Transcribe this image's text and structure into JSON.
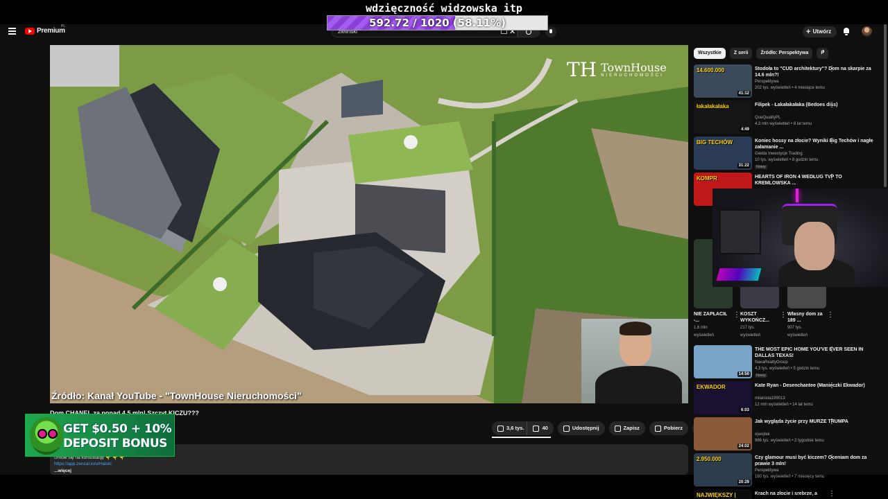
{
  "overlay": {
    "title": "wdzięczność widzowska itp",
    "goal_text": "592.72 / 1020 (58.11%)",
    "goal_fraction": 0.5811
  },
  "masthead": {
    "logo_text": "Premium",
    "logo_country": "PL",
    "search_value": "zieliński",
    "create_label": "Utwórz"
  },
  "video": {
    "watermark_mark": "TH",
    "watermark_brand": "TownHouse",
    "watermark_sub": "NIERUCHOMOŚCI",
    "source_caption": "Źródło: Kanał YouTube - \"TownHouse Nieruchomości\"",
    "title": "Dom CHANEL za ponad 4,5 mln! Szczyt KICZU???"
  },
  "actions": {
    "likes": "3,6 tys.",
    "dislikes": "40",
    "share": "Udostępnij",
    "save": "Zapisz",
    "download": "Pobierz"
  },
  "description": {
    "line1": "Umów się na konsultację 👇 👇 👇",
    "link": "https://app.zencal.io/u/Halski",
    "more": "...więcej"
  },
  "ad": {
    "line1": "GET $0.50 + 10%",
    "line2": "DEPOSIT BONUS"
  },
  "chips": [
    "Wszystkie",
    "Z serii",
    "Źródło: Perspektywa",
    "P"
  ],
  "recommendations": [
    {
      "title": "Stodoła to \"CUD architektury\"? Dom na skarpie za 14.6 mln?!",
      "channel": "Perspektywa",
      "meta": "202 tys. wyświetleń • 4 miesiące temu",
      "duration": "41:12",
      "thumb_text": "14.600.000",
      "thumb_color": "#3a4a5a"
    },
    {
      "title": "Filipek - Łakałakałaka (Bedoes diss)",
      "channel": "QueQualityPL",
      "meta": "4,3 mln wyświetleń • 8 lat temu",
      "duration": "4:49",
      "thumb_text": "łakałakałaka",
      "thumb_color": "#151515"
    },
    {
      "title": "Koniec hossy na złocie? Wyniki Big Techów i nagłe załamanie ...",
      "channel": "Giełda Inwestycje Trading",
      "meta": "10 tys. wyświetleń • 8 godzin temu",
      "duration": "31:22",
      "badge": "Nowy",
      "thumb_text": "BIG TECHÓW",
      "thumb_color": "#2b3a55"
    },
    {
      "title": "HEARTS OF IRON 4 WEDŁUG TVP TO KREMLOWSKA ...",
      "channel": "",
      "meta": "",
      "duration": "",
      "thumb_text": "KOMPR",
      "thumb_color": "#c01818"
    },
    {
      "title": "THE MOST EPIC HOME YOU'VE EVER SEEN IN DALLAS TEXAS!",
      "channel": "NavaRealtyGroup",
      "meta": "4,3 tys. wyświetleń • 5 godzin temu",
      "duration": "14:50",
      "badge": "Nowy",
      "thumb_text": "",
      "thumb_color": "#7aa3c8"
    },
    {
      "title": "Kate Ryan - Desenchantee (Manieczki Ekwador)",
      "channel": "milanista199013",
      "meta": "12 mln wyświetleń • 14 lat temu",
      "duration": "6:03",
      "thumb_text": "EKWADOR",
      "thumb_color": "#1a1030"
    },
    {
      "title": "Jak wygląda życie przy MURZE TRUMPA",
      "channel": "ojwojtek",
      "meta": "986 tys. wyświetleń • 2 tygodnie temu",
      "duration": "24:02",
      "thumb_text": "",
      "thumb_color": "#8a5a3a"
    },
    {
      "title": "Czy glamour musi być kiczem? Oceniam dom za prawie 3 mln!",
      "channel": "Perspektywa",
      "meta": "160 tys. wyświetleń • 7 miesięcy temu",
      "duration": "20:29",
      "thumb_text": "2.950.000",
      "thumb_color": "#2e3d4d"
    },
    {
      "title": "Krach na złocie i srebrze, a",
      "channel": "",
      "meta": "",
      "duration": "",
      "thumb_text": "NAJWIĘKSZY | WYNIKI",
      "thumb_color": "#0c0c0c"
    }
  ],
  "shorts": [
    {
      "title": "NIE ZAPŁACIŁ -...",
      "meta1": "1,6 mln",
      "meta2": "wyświetleń"
    },
    {
      "title": "KOSZT WYKOŃCZ...",
      "meta1": "217 tys.",
      "meta2": "wyświetleń"
    },
    {
      "title": "Własny dom za 189 ...",
      "meta1": "907 tys.",
      "meta2": "wyświetleń"
    }
  ]
}
